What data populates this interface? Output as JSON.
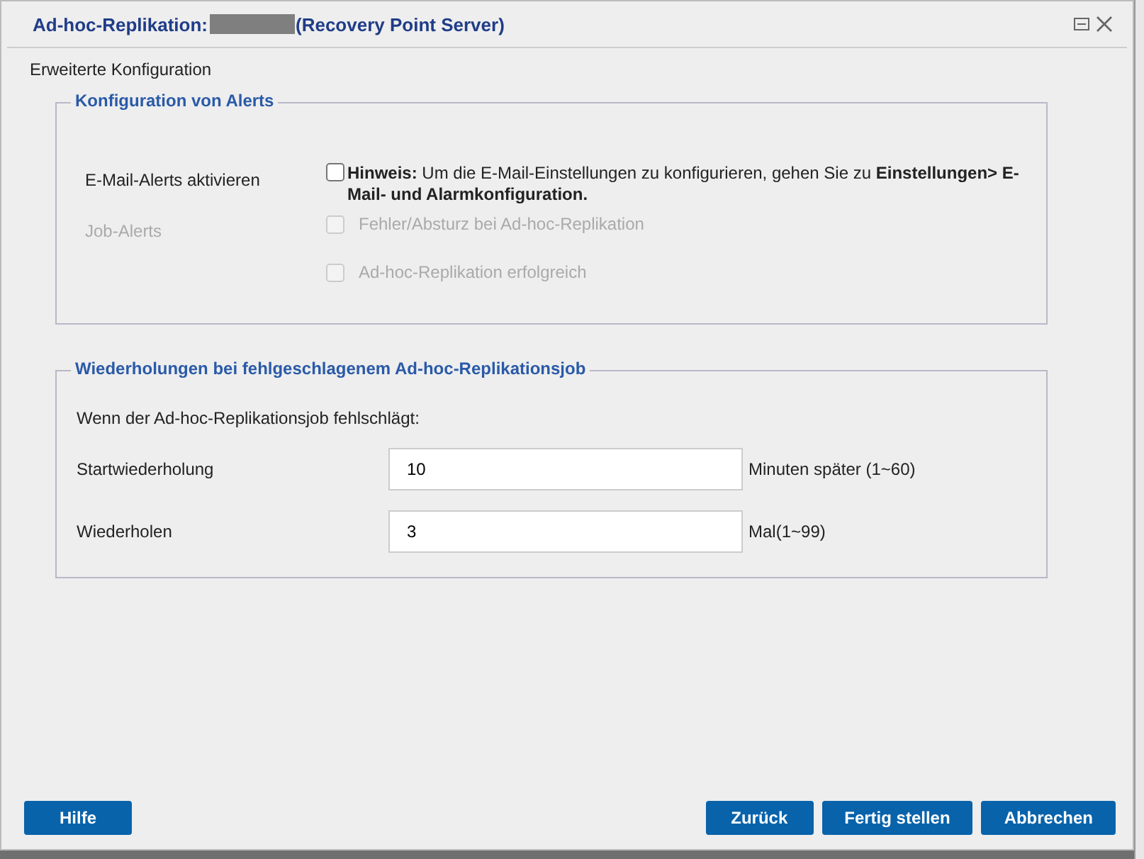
{
  "window": {
    "title_prefix": "Ad-hoc-Replikation:",
    "title_suffix": "(Recovery Point Server)"
  },
  "section_label": "Erweiterte Konfiguration",
  "alerts": {
    "legend": "Konfiguration von Alerts",
    "email": {
      "label": "E-Mail-Alerts aktivieren",
      "checked": false,
      "disabled": false,
      "note": "**Hinweis:** Um die E-Mail-Einstellungen zu konfigurieren, gehen Sie zu **Einstellungen> E-Mail- und Alarmkonfiguration.**"
    },
    "job_alerts": {
      "label": "Job-Alerts",
      "disabled": true,
      "options": [
        {
          "label": "Fehler/Absturz bei Ad-hoc-Replikation",
          "checked": false,
          "disabled": true
        },
        {
          "label": "Ad-hoc-Replikation erfolgreich",
          "checked": false,
          "disabled": true
        }
      ]
    }
  },
  "retries": {
    "legend": "Wiederholungen bei fehlgeschlagenem Ad-hoc-Replikationsjob",
    "intro": "Wenn der Ad-hoc-Replikationsjob fehlschlägt:",
    "fields": [
      {
        "label": "Startwiederholung",
        "value": "10",
        "unit": "Minuten später (1~60)"
      },
      {
        "label": "Wiederholen",
        "value": "3",
        "unit": "Mal(1~99)"
      }
    ]
  },
  "buttons_left": [
    "Hilfe"
  ],
  "buttons_right": [
    "Zurück",
    "Fertig stellen",
    "Abbrechen"
  ]
}
